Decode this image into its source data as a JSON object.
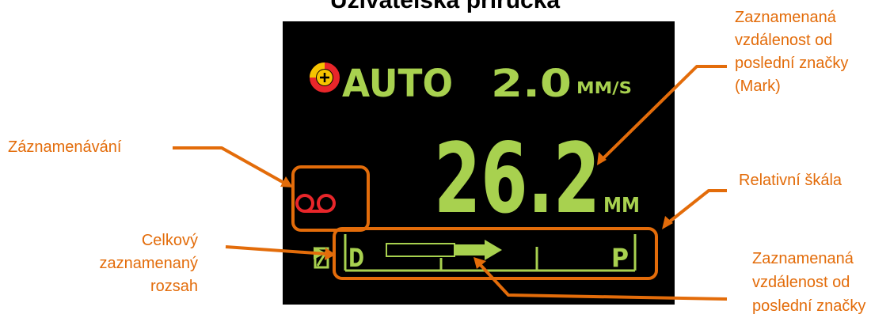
{
  "page_title": "Uživatelská příručka",
  "display": {
    "mode": "AUTO",
    "speed_value": "2.0",
    "speed_unit": "MM/S",
    "distance_value": "26.2",
    "distance_unit": "MM",
    "scale_left_letter": "D",
    "scale_right_letter": "P"
  },
  "callouts": {
    "recording": "Záznamenávání",
    "distance_top": [
      "Zaznamenaná",
      "vzdálenost od",
      "poslední značky",
      "(Mark)"
    ],
    "relative_scale": "Relativní škála",
    "total_range": [
      "Celkový",
      "zaznamenaný",
      "rozsah"
    ],
    "distance_bottom": [
      "Zaznamenaná",
      "vzdálenost od",
      "poslední značky"
    ]
  },
  "colors": {
    "lcd_green": "#a8d14f",
    "callout_orange": "#e36c0a",
    "record_red": "#e8262a",
    "screen_bg": "#000000"
  },
  "icons": [
    "gauge-plus-icon",
    "record-tape-icon",
    "speed-arrow-icon"
  ]
}
